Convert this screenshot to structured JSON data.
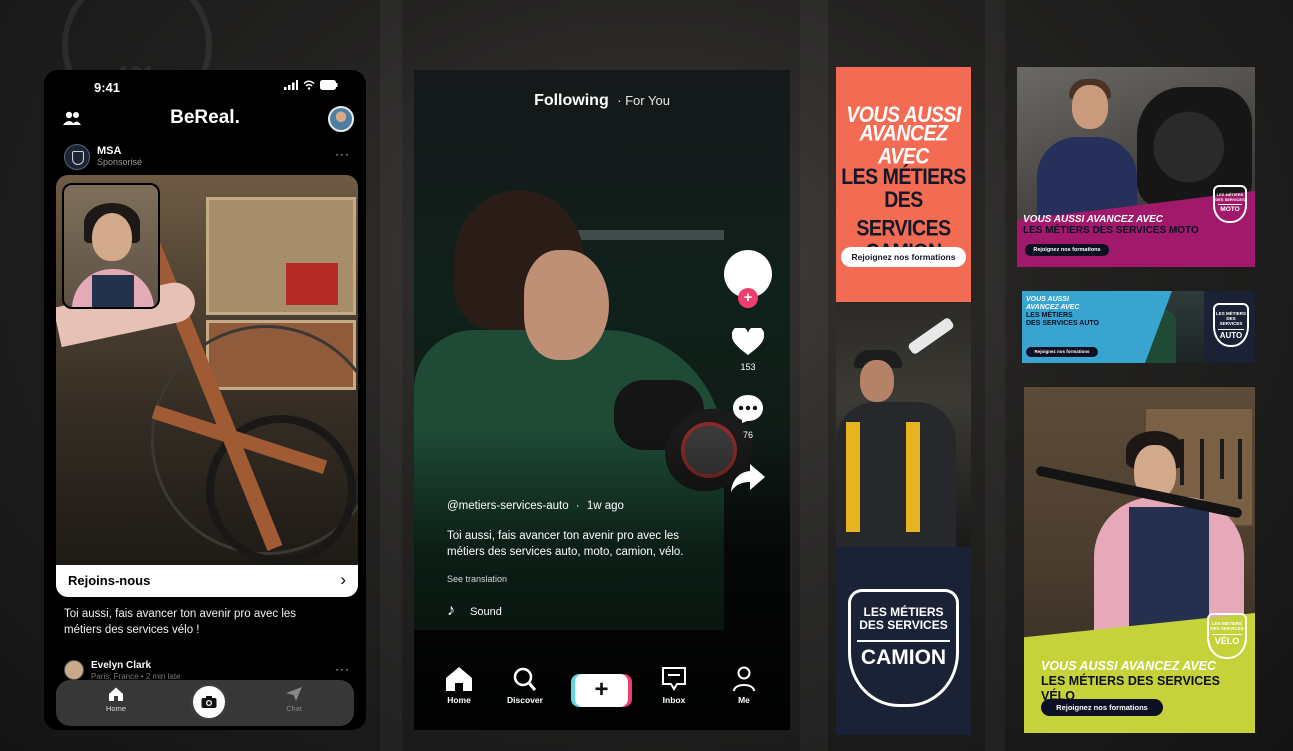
{
  "bereal": {
    "status_time": "9:41",
    "logo": "BeReal.",
    "sponsor_name": "MSA",
    "sponsor_label": "Sponsorisé",
    "more": "···",
    "cta_label": "Rejoins-nous",
    "cta_chevron": "›",
    "caption": "Toi aussi, fais avancer ton avenir pro avec les métiers des services vélo !",
    "commenter_name": "Evelyn Clark",
    "commenter_meta": "Paris, France • 2 min late",
    "tabs": {
      "home": "Home",
      "chat": "Chat"
    }
  },
  "tiktok": {
    "nav_following": "Following",
    "nav_for_you": "· For You",
    "likes": "153",
    "comments": "76",
    "follow_plus": "+",
    "username": "@metiers-services-auto",
    "posted": "1w ago",
    "dot": "·",
    "description": "Toi aussi, fais avancer ton avenir pro avec les métiers des services auto, moto, camion, vélo.",
    "see_translation": "See translation",
    "sound_note": "♪",
    "sound": "Sound",
    "create": "+",
    "tabs": {
      "home": "Home",
      "discover": "Discover",
      "inbox": "Inbox",
      "me": "Me"
    }
  },
  "ads": {
    "camion": {
      "line1": "VOUS AUSSI",
      "line2": "AVANCEZ AVEC",
      "line3": "LES MÉTIERS",
      "line4": "DES SERVICES",
      "line5": "CAMION",
      "cta": "Rejoignez nos formations",
      "shield_1": "LES MÉTIERS",
      "shield_2": "DES SERVICES",
      "shield_3": "CAMION"
    },
    "moto": {
      "headline_1": "VOUS AUSSI AVANCEZ AVEC",
      "headline_2": "LES MÉTIERS DES SERVICES MOTO",
      "cta": "Rejoignez nos formations",
      "shield_1": "LES MÉTIERS",
      "shield_2": "DES SERVICES",
      "shield_3": "MOTO"
    },
    "auto": {
      "headline_1": "VOUS AUSSI",
      "headline_2": "AVANCEZ AVEC",
      "headline_3": "LES MÉTIERS",
      "headline_4": "DES SERVICES AUTO",
      "cta": "Rejoignez nos formations",
      "shield_1": "LES MÉTIERS",
      "shield_2": "DES SERVICES",
      "shield_3": "AUTO"
    },
    "velo": {
      "headline_1": "VOUS AUSSI AVANCEZ AVEC",
      "headline_2": "LES MÉTIERS DES SERVICES VÉLO",
      "cta": "Rejoignez nos formations",
      "shield_1": "LES MÉTIERS",
      "shield_2": "DES SERVICES",
      "shield_3": "VÉLO"
    }
  },
  "background": {
    "sign_number": "131"
  },
  "colors": {
    "camion_orange": "#f36b52",
    "navy": "#1b2236",
    "moto_magenta": "#a1196a",
    "auto_blue": "#39a4cf",
    "velo_lime": "#c6d23a",
    "tiktok_pink": "#ee3e6d",
    "tiktok_cyan": "#5fd8e3"
  },
  "icons": [
    "friends-icon",
    "signal-icon",
    "wifi-icon",
    "battery-icon",
    "home-icon",
    "camera-icon",
    "send-icon",
    "heart-icon",
    "comment-icon",
    "share-icon",
    "search-icon",
    "inbox-icon",
    "profile-icon",
    "music-note-icon",
    "shield-logo-icon"
  ]
}
